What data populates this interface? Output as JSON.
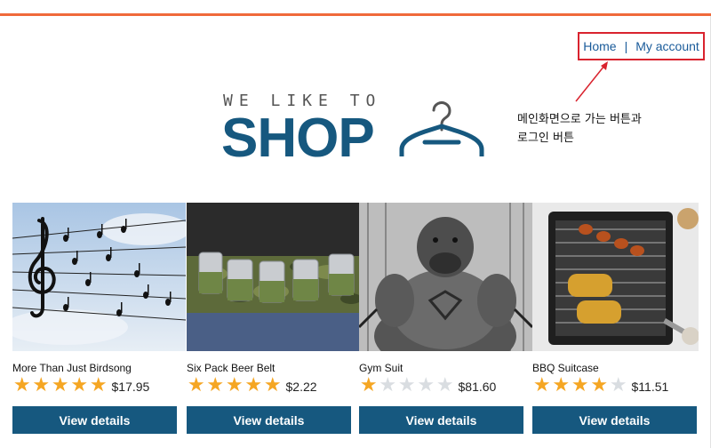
{
  "nav": {
    "home": "Home",
    "separator": "|",
    "account": "My account"
  },
  "annotation": {
    "line1": "메인화면으로 가는 버튼과",
    "line2": "로그인 버튼"
  },
  "logo": {
    "tagline": "WE LIKE TO",
    "word": "SHOP",
    "icon": "hanger-icon"
  },
  "colors": {
    "accent": "#f0693a",
    "brand": "#16587f",
    "star": "#f5a623",
    "annotation_box": "#d9232e"
  },
  "products": [
    {
      "name": "More Than Just Birdsong",
      "rating": 5,
      "max_rating": 5,
      "price": "$17.95",
      "button": "View details"
    },
    {
      "name": "Six Pack Beer Belt",
      "rating": 5,
      "max_rating": 5,
      "price": "$2.22",
      "button": "View details"
    },
    {
      "name": "Gym Suit",
      "rating": 1,
      "max_rating": 5,
      "price": "$81.60",
      "button": "View details"
    },
    {
      "name": "BBQ Suitcase",
      "rating": 4,
      "max_rating": 5,
      "price": "$11.51",
      "button": "View details"
    }
  ]
}
